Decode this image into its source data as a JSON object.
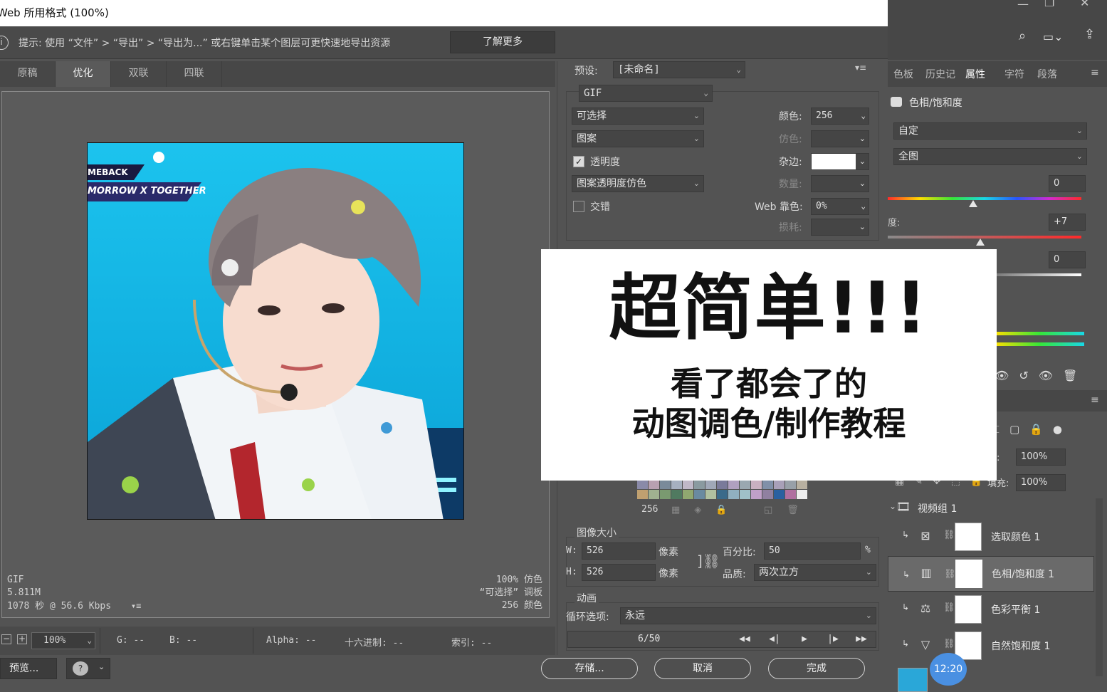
{
  "dialog": {
    "title": "Web 所用格式 (100%)",
    "hint": "提示: 使用 “文件” > “导出” > “导出为...” 或右键单击某个图层可更快速地导出资源",
    "learn_more": "了解更多",
    "tabs": [
      "原稿",
      "优化",
      "双联",
      "四联"
    ],
    "active_tab": "优化"
  },
  "preview": {
    "banner_line1": "MEBACK",
    "banner_line2": "MORROW X TOGETHER",
    "info_format": "GIF",
    "info_size": "5.811M",
    "info_time": "1078 秒 @ 56.6 Kbps",
    "info_dither": "100% 仿色",
    "info_palette": "“可选择” 调板",
    "info_colors": "256 颜色"
  },
  "status": {
    "zoom": "100%",
    "g": "G: --",
    "b": "B: --",
    "alpha": "Alpha: --",
    "hex": "十六进制: --",
    "index": "索引: --"
  },
  "bottom": {
    "preview_btn": "预览...",
    "save": "存储...",
    "cancel": "取消",
    "done": "完成"
  },
  "settings": {
    "preset_label": "预设:",
    "preset_value": "[未命名]",
    "format": "GIF",
    "reduction": "可选择",
    "dither_algo": "图案",
    "transparency_label": "透明度",
    "transparency_dither": "图案透明度仿色",
    "interlace_label": "交错",
    "colors_label": "颜色:",
    "colors_value": "256",
    "dither_label": "仿色:",
    "matte_label": "杂边:",
    "amount_label": "数量:",
    "web_snap_label": "Web 靠色:",
    "web_snap_value": "0%",
    "lossy_label": "损耗:",
    "color_count": "256",
    "image_size_header": "图像大小",
    "w_label": "W:",
    "w_value": "526",
    "h_label": "H:",
    "h_value": "526",
    "px_unit": "像素",
    "percent_label": "百分比:",
    "percent_value": "50",
    "percent_unit": "%",
    "quality_label": "品质:",
    "quality_value": "两次立方",
    "animation_header": "动画",
    "loop_label": "循环选项:",
    "loop_value": "永远",
    "frame_counter": "6/50"
  },
  "overlay": {
    "title": "超简单!!!",
    "sub1": "看了都会了的",
    "sub2": "动图调色/制作教程"
  },
  "ps_panel": {
    "tabs": [
      "色板",
      "历史记",
      "属性",
      "字符",
      "段落"
    ],
    "active_tab": "属性",
    "adjust_title": "色相/饱和度",
    "preset_value": "自定",
    "channel_value": "全图",
    "hue_value": "0",
    "saturation_label": "度:",
    "saturation_value": "+7",
    "lightness_value": "0",
    "opacity_label": "度:",
    "opacity_value": "100%",
    "fill_label": "填充:",
    "fill_value": "100%",
    "group_name": "视频组 1",
    "layers": [
      "选取颜色 1",
      "色相/饱和度 1",
      "色彩平衡 1",
      "自然饱和度 1"
    ],
    "selected_layer": "色相/饱和度 1",
    "time": "12:20"
  }
}
